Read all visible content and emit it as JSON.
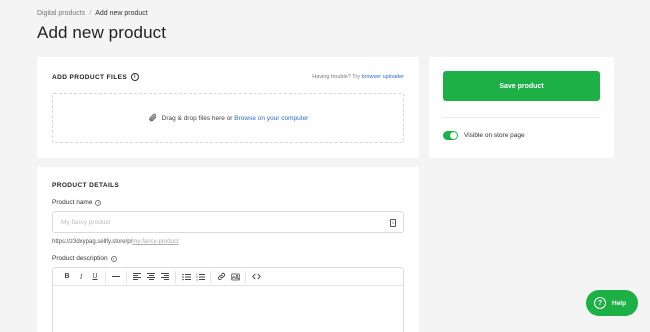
{
  "breadcrumb": {
    "parent": "Digital products",
    "separator": "/",
    "current": "Add new product"
  },
  "page_title": "Add new product",
  "files": {
    "title": "ADD PRODUCT FILES",
    "trouble_text": "Having trouble? Try ",
    "trouble_link": "browser uploader",
    "drop_text": "Drag & drop files here or ",
    "browse_link": "Browse on your computer"
  },
  "save": {
    "button_label": "Save product",
    "visible_label": "Visible on store page",
    "visible_on": true
  },
  "details": {
    "title": "PRODUCT DETAILS",
    "name_label": "Product name",
    "name_placeholder": "My fancy product",
    "url_prefix": "https://z3dxypag.sellfy.store/p/",
    "url_slug": "my-fancy-product",
    "description_label": "Product description"
  },
  "help": {
    "label": "Help"
  },
  "colors": {
    "accent": "#1db046",
    "link": "#2e6bd1"
  }
}
